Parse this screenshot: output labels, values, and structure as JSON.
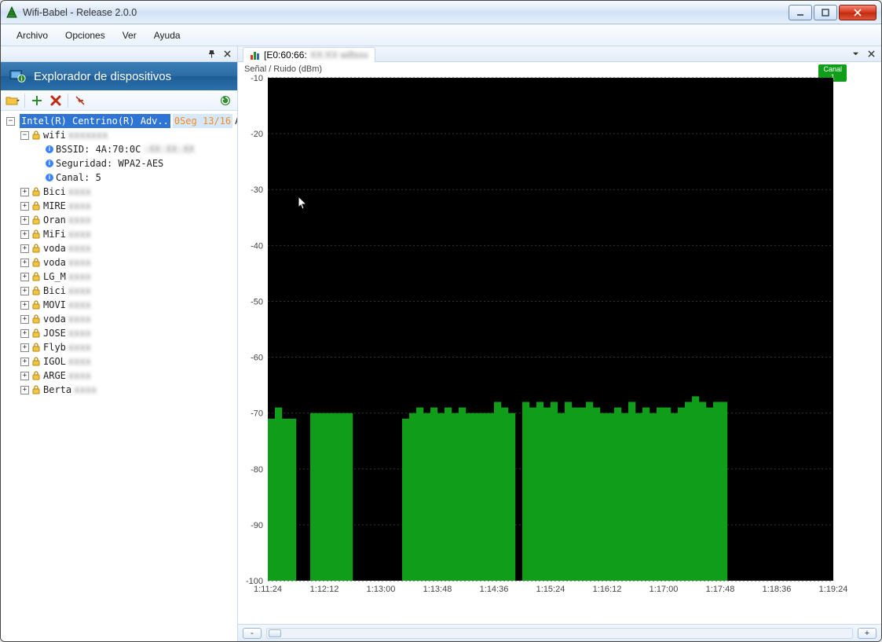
{
  "window": {
    "title": "Wifi-Babel - Release 2.0.0"
  },
  "menu": {
    "archivo": "Archivo",
    "opciones": "Opciones",
    "ver": "Ver",
    "ayuda": "Ayuda"
  },
  "left_panel": {
    "title": "Explorador de dispositivos"
  },
  "tree": {
    "root": {
      "label": "Intel(R) Centrino(R) Adv..",
      "extra": "0Seg 13/16",
      "suffix": "Ap"
    },
    "selected": {
      "label": "wifi",
      "bssid_label": "BSSID:",
      "bssid_value": "4A:70:0C",
      "security_label": "Seguridad:",
      "security_value": "WPA2-AES",
      "channel_label": "Canal:",
      "channel_value": "5"
    },
    "networks": [
      "Bici",
      "MIRE",
      "Oran",
      "MiFi",
      "voda",
      "voda",
      "LG_M",
      "Bici",
      "MOVI",
      "voda",
      "JOSE",
      "Flyb",
      "IGOL",
      "ARGE",
      "Berta"
    ]
  },
  "tab": {
    "label": "[E0:60:66:"
  },
  "chart": {
    "ylabel": "Señal / Ruido (dBm)",
    "badge_top": "Canal",
    "badge_val": "1"
  },
  "chart_data": {
    "type": "bar",
    "title": "Señal / Ruido (dBm)",
    "xlabel": "",
    "ylabel": "Señal / Ruido (dBm)",
    "ylim": [
      -100,
      -10
    ],
    "x_ticks": [
      "1:11:24",
      "1:12:12",
      "1:13:00",
      "1:13:48",
      "1:14:36",
      "1:15:24",
      "1:16:12",
      "1:17:00",
      "1:17:48",
      "1:18:36",
      "1:19:24"
    ],
    "y_ticks": [
      -10,
      -20,
      -30,
      -40,
      -50,
      -60,
      -70,
      -80,
      -90,
      -100
    ],
    "series": [
      {
        "name": "Señal",
        "color": "#0f9d1a",
        "x": [
          "1:11:24",
          "1:11:30",
          "1:11:36",
          "1:11:42",
          "1:11:48",
          "1:11:54",
          "1:12:00",
          "1:12:06",
          "1:12:12",
          "1:12:18",
          "1:12:24",
          "1:12:30",
          "1:12:36",
          "1:12:42",
          "1:12:48",
          "1:12:54",
          "1:13:00",
          "1:13:06",
          "1:13:12",
          "1:13:18",
          "1:13:24",
          "1:13:30",
          "1:13:36",
          "1:13:42",
          "1:13:48",
          "1:13:54",
          "1:14:00",
          "1:14:06",
          "1:14:12",
          "1:14:18",
          "1:14:24",
          "1:14:30",
          "1:14:36",
          "1:14:42",
          "1:14:48",
          "1:14:54",
          "1:15:00",
          "1:15:06",
          "1:15:12",
          "1:15:18",
          "1:15:24",
          "1:15:30",
          "1:15:36",
          "1:15:42",
          "1:15:48",
          "1:15:54",
          "1:16:00",
          "1:16:06",
          "1:16:12",
          "1:16:18",
          "1:16:24",
          "1:16:30",
          "1:16:36",
          "1:16:42",
          "1:16:48",
          "1:16:54",
          "1:17:00",
          "1:17:06",
          "1:17:12",
          "1:17:18",
          "1:17:24",
          "1:17:30",
          "1:17:36",
          "1:17:42",
          "1:17:48",
          "1:17:54",
          "1:18:00",
          "1:18:06",
          "1:18:12",
          "1:18:18",
          "1:18:24",
          "1:18:30",
          "1:18:36",
          "1:18:42",
          "1:18:48",
          "1:18:54",
          "1:19:00",
          "1:19:06",
          "1:19:12",
          "1:19:18"
        ],
        "values": [
          -71,
          -69,
          -71,
          -71,
          null,
          null,
          -70,
          -70,
          -70,
          -70,
          -70,
          -70,
          null,
          null,
          null,
          null,
          null,
          null,
          null,
          -71,
          -70,
          -69,
          -70,
          -69,
          -70,
          -69,
          -70,
          -69,
          -70,
          -70,
          -70,
          -70,
          -68,
          -69,
          -70,
          null,
          -68,
          -69,
          -68,
          -69,
          -68,
          -70,
          -68,
          -69,
          -69,
          -68,
          -69,
          -70,
          -70,
          -69,
          -70,
          -68,
          -70,
          -69,
          -70,
          -69,
          -69,
          -70,
          -69,
          -68,
          -67,
          -68,
          -69,
          -68,
          -68,
          null,
          null,
          null,
          null,
          null,
          null,
          null,
          null,
          null,
          null,
          null,
          null,
          null,
          null,
          null
        ]
      }
    ]
  }
}
